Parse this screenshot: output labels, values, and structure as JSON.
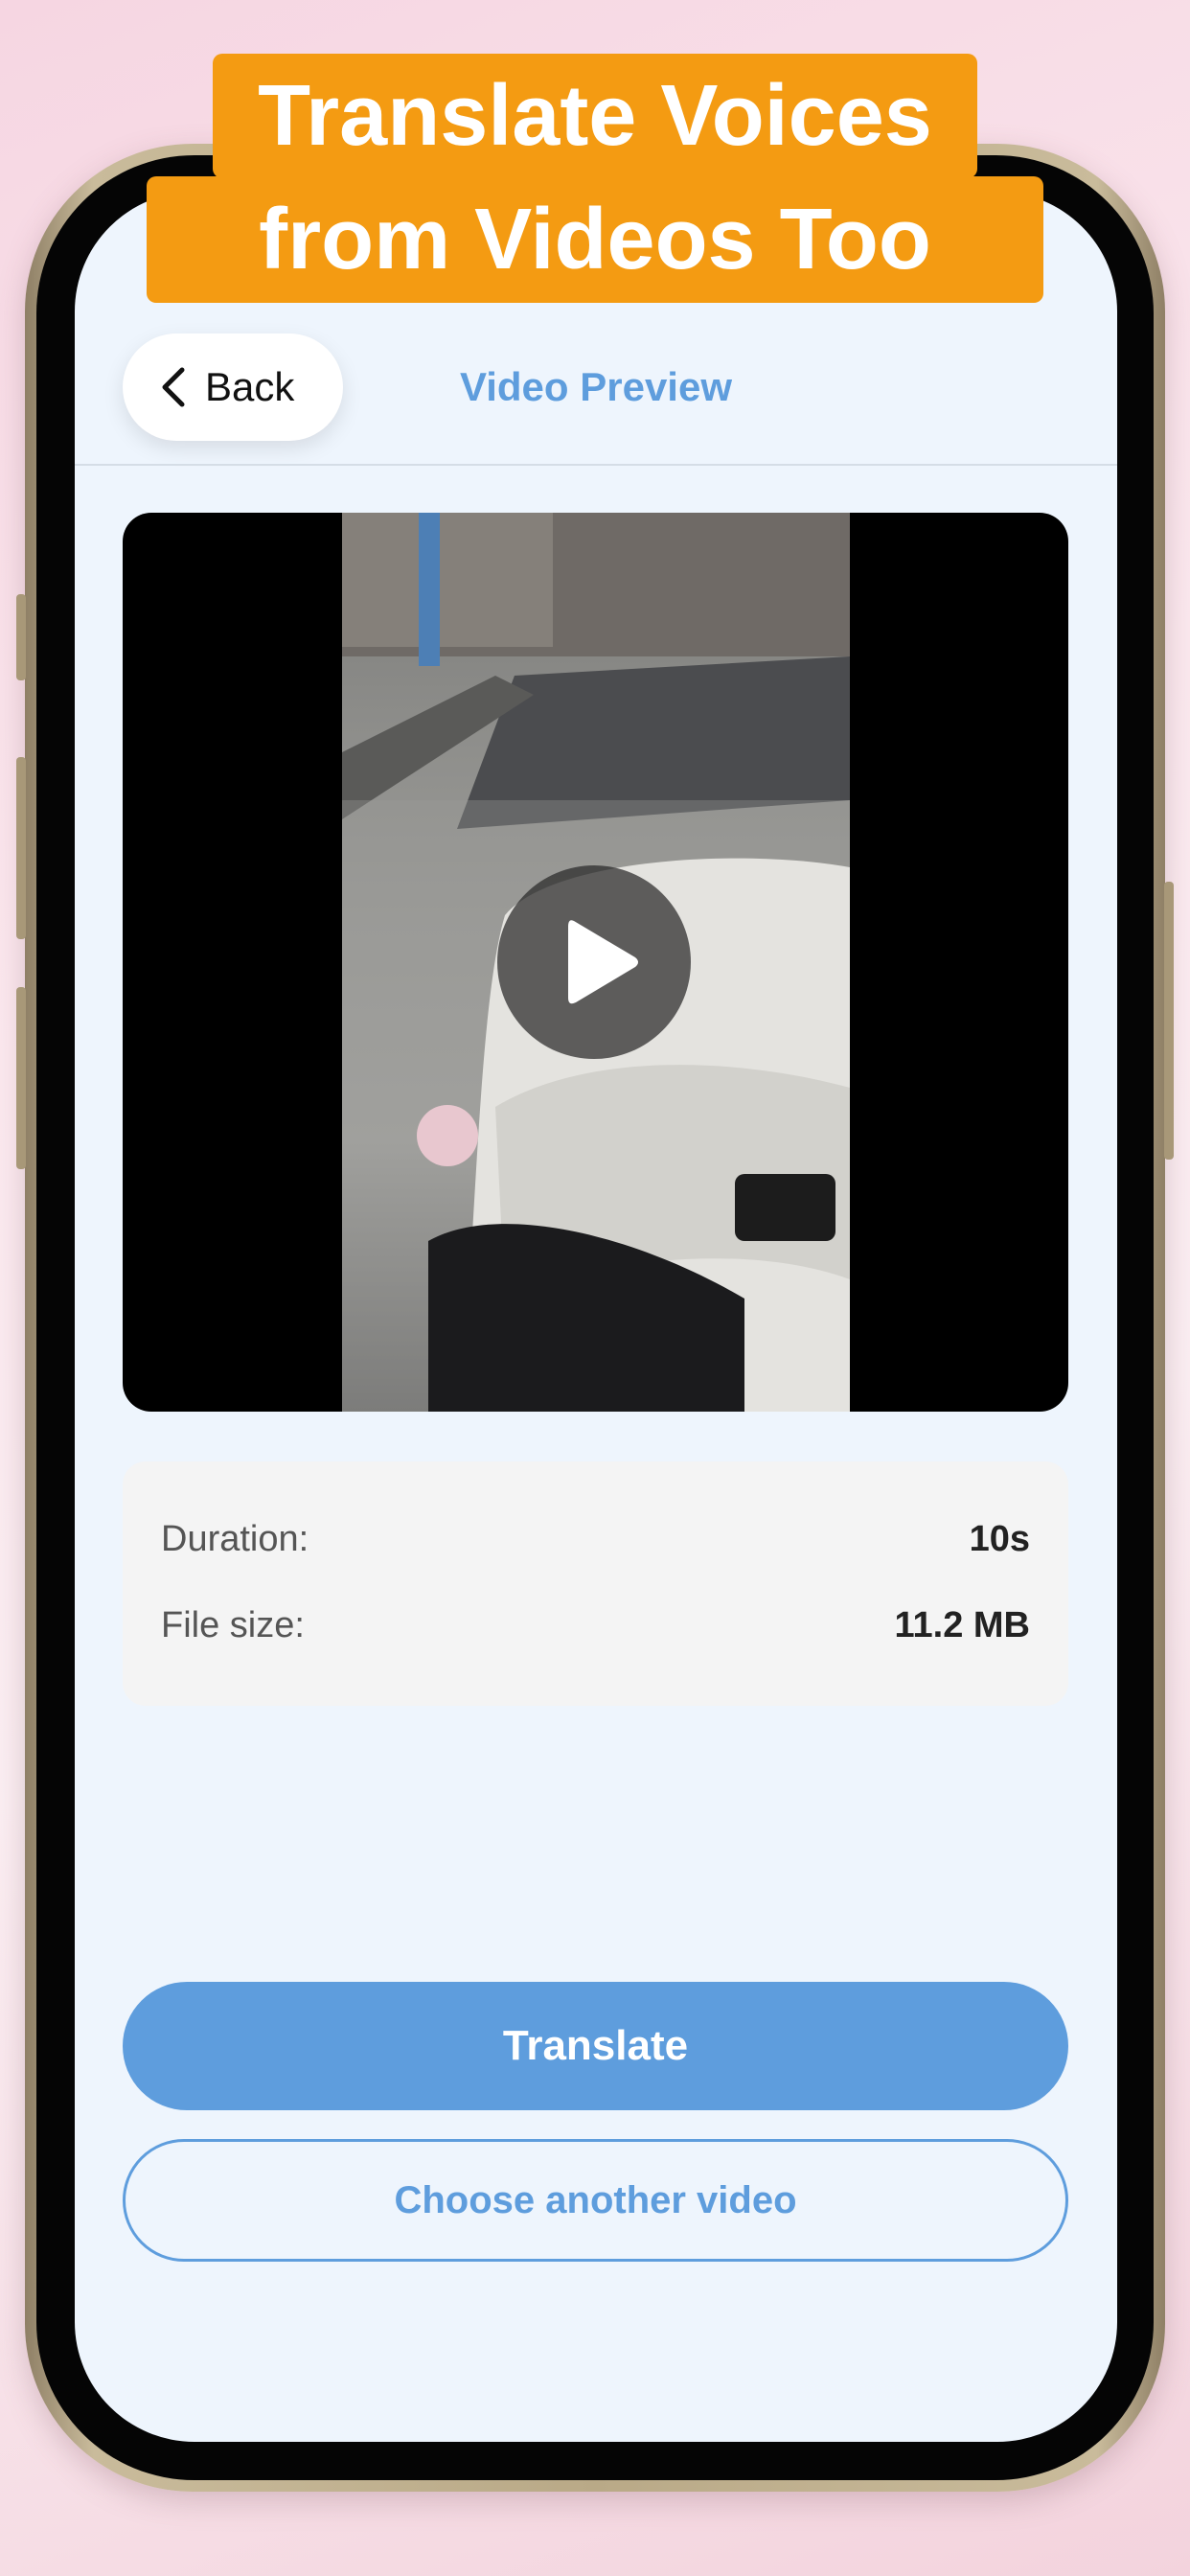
{
  "banner": {
    "line1": "Translate Voices",
    "line2": "from Videos Too"
  },
  "nav": {
    "back_label": "Back",
    "title": "Video Preview"
  },
  "video": {
    "play_icon": "play-icon"
  },
  "info": {
    "duration_label": "Duration:",
    "duration_value": "10s",
    "filesize_label": "File size:",
    "filesize_value": "11.2 MB"
  },
  "actions": {
    "translate_label": "Translate",
    "choose_label": "Choose another video"
  },
  "colors": {
    "accent": "#5e9ddd",
    "banner": "#f49b12",
    "screen_bg": "#eef5fd"
  }
}
